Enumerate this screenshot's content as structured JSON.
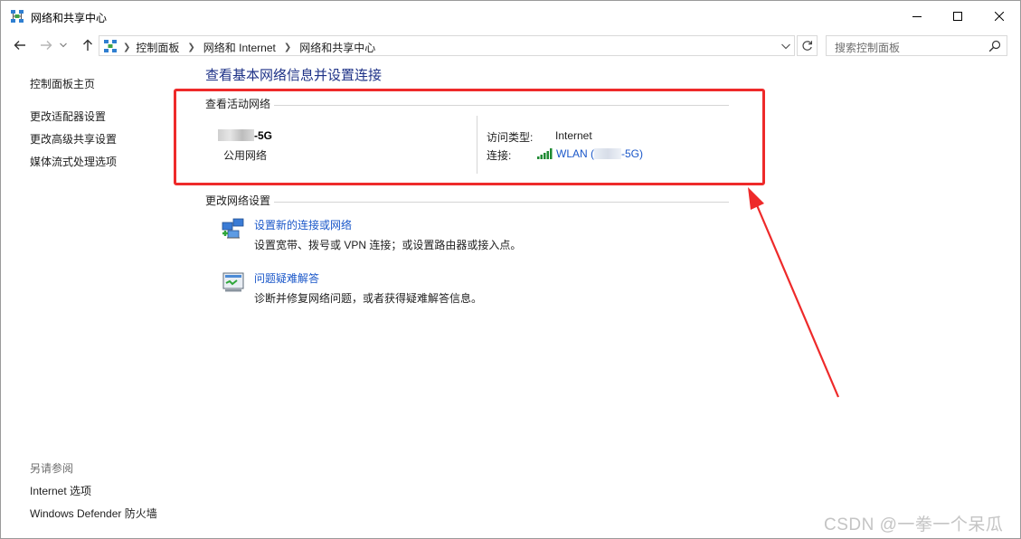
{
  "window": {
    "title": "网络和共享中心",
    "minimize_label": "",
    "maximize_label": "",
    "close_label": ""
  },
  "address_bar": {
    "crumbs": [
      "控制面板",
      "网络和 Internet",
      "网络和共享中心"
    ],
    "search_placeholder": "搜索控制面板"
  },
  "left_pane": {
    "home_link": "控制面板主页",
    "links": [
      "更改适配器设置",
      "更改高级共享设置",
      "媒体流式处理选项"
    ],
    "see_also_heading": "另请参阅",
    "see_also": [
      "Internet 选项",
      "Windows Defender 防火墙"
    ]
  },
  "main": {
    "title": "查看基本网络信息并设置连接",
    "active_networks_heading": "查看活动网络",
    "network": {
      "name_suffix": "-5G",
      "kind": "公用网络",
      "access_type_label": "访问类型:",
      "access_type_value": "Internet",
      "connection_label": "连接:",
      "connection_link_prefix": "WLAN (",
      "connection_link_suffix": "-5G)"
    },
    "change_settings_heading": "更改网络设置",
    "tasks": [
      {
        "link": "设置新的连接或网络",
        "description": "设置宽带、拨号或 VPN 连接；或设置路由器或接入点。"
      },
      {
        "link": "问题疑难解答",
        "description": "诊断并修复网络问题，或者获得疑难解答信息。"
      }
    ]
  },
  "colors": {
    "link": "#1a57c9",
    "title": "#1e3287",
    "annotation": "#ee2a2a"
  },
  "watermark": "CSDN @一拳一个呆瓜"
}
